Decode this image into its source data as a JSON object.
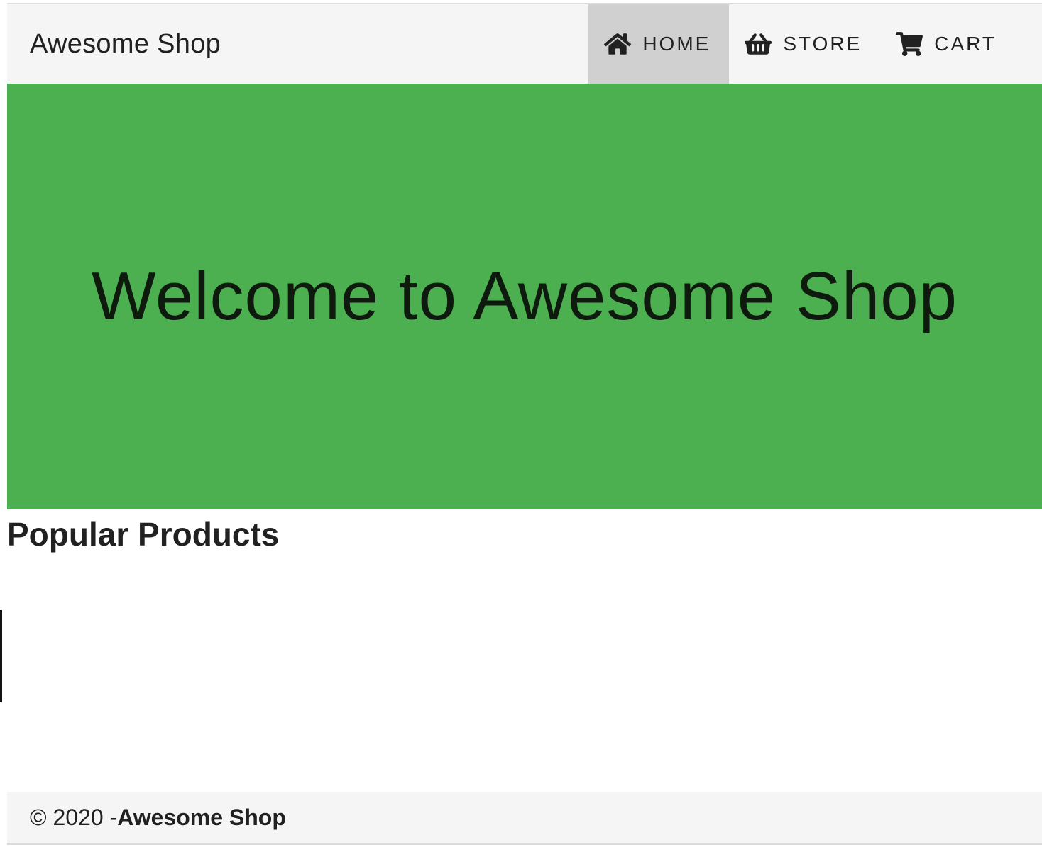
{
  "navbar": {
    "brand": "Awesome Shop",
    "items": [
      {
        "label": "HOME",
        "icon": "home-icon",
        "active": true
      },
      {
        "label": "STORE",
        "icon": "basket-icon",
        "active": false
      },
      {
        "label": "CART",
        "icon": "cart-icon",
        "active": false
      }
    ]
  },
  "hero": {
    "title": "Welcome to Awesome Shop",
    "background": "#4caf50"
  },
  "main": {
    "section_title": "Popular Products"
  },
  "footer": {
    "copyright": "© 2020 -",
    "brand": "Awesome Shop"
  }
}
